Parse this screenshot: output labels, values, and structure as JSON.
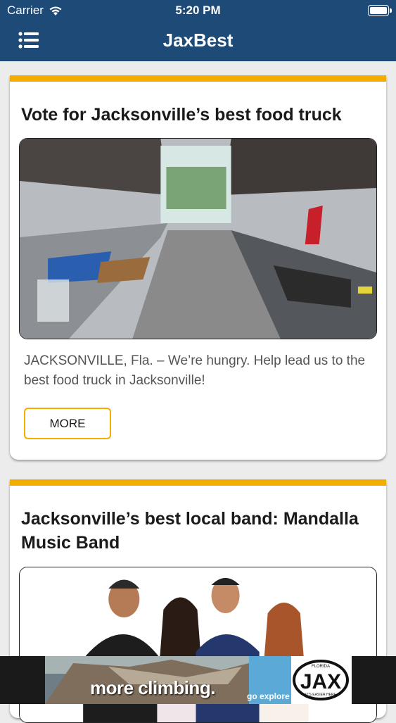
{
  "status_bar": {
    "carrier": "Carrier",
    "time": "5:20 PM"
  },
  "nav": {
    "title": "JaxBest",
    "menu_icon": "hamburger-menu-icon"
  },
  "accent_color": "#f3ac00",
  "nav_color": "#1d4a77",
  "cards": [
    {
      "title": "Vote for Jacksonville’s best food truck",
      "body": "JACKSONVILLE, Fla. – We’re hungry. Help lead us to the best food truck in Jacksonville!",
      "button_label": "MORE"
    },
    {
      "title": "Jacksonville’s best local band: Mandalla Music Band"
    }
  ],
  "ad": {
    "headline": "more climbing.",
    "tagline": "go explore",
    "logo_text": "JAX",
    "logo_top": "FLORIDA",
    "logo_bottom": "IT'S EASIER HERE"
  }
}
